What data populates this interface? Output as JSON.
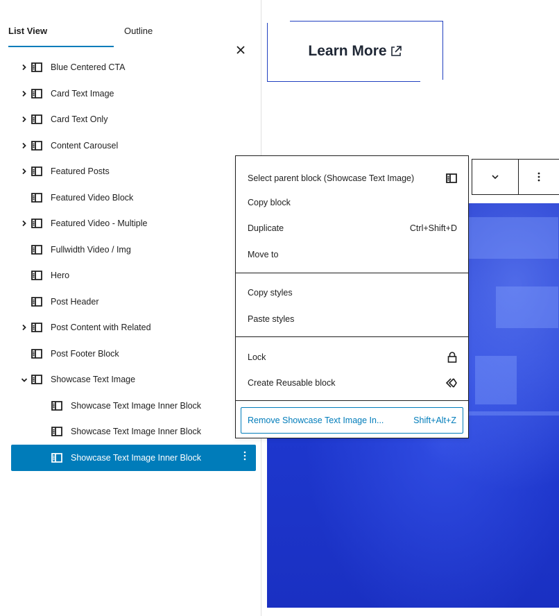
{
  "panel": {
    "tabs": {
      "list_view": "List View",
      "outline": "Outline"
    },
    "close": "×",
    "items": [
      {
        "label": "Blue Centered CTA",
        "expandable": true,
        "expanded": false,
        "depth": 0
      },
      {
        "label": "Card Text Image",
        "expandable": true,
        "expanded": false,
        "depth": 0
      },
      {
        "label": "Card Text Only",
        "expandable": true,
        "expanded": false,
        "depth": 0
      },
      {
        "label": "Content Carousel",
        "expandable": true,
        "expanded": false,
        "depth": 0
      },
      {
        "label": "Featured Posts",
        "expandable": true,
        "expanded": false,
        "depth": 0
      },
      {
        "label": "Featured Video Block",
        "expandable": false,
        "expanded": false,
        "depth": 0
      },
      {
        "label": "Featured Video - Multiple",
        "expandable": true,
        "expanded": false,
        "depth": 0
      },
      {
        "label": "Fullwidth Video / Img",
        "expandable": false,
        "expanded": false,
        "depth": 0
      },
      {
        "label": "Hero",
        "expandable": false,
        "expanded": false,
        "depth": 0
      },
      {
        "label": "Post Header",
        "expandable": false,
        "expanded": false,
        "depth": 0
      },
      {
        "label": "Post Content with Related",
        "expandable": true,
        "expanded": false,
        "depth": 0
      },
      {
        "label": "Post Footer Block",
        "expandable": false,
        "expanded": false,
        "depth": 0
      },
      {
        "label": "Showcase Text Image",
        "expandable": true,
        "expanded": true,
        "depth": 0
      },
      {
        "label": "Showcase Text Image Inner Block",
        "expandable": false,
        "expanded": false,
        "depth": 1
      },
      {
        "label": "Showcase Text Image Inner Block",
        "expandable": false,
        "expanded": false,
        "depth": 1
      },
      {
        "label": "Showcase Text Image Inner Block",
        "expandable": false,
        "expanded": false,
        "depth": 1,
        "selected": true
      }
    ]
  },
  "canvas": {
    "learn_more": "Learn More"
  },
  "menu": {
    "select_parent": "Select parent block (Showcase Text Image)",
    "copy_block": "Copy block",
    "duplicate": "Duplicate",
    "duplicate_shortcut": "Ctrl+Shift+D",
    "move_to": "Move to",
    "copy_styles": "Copy styles",
    "paste_styles": "Paste styles",
    "lock": "Lock",
    "create_reusable": "Create Reusable block",
    "remove": "Remove Showcase Text Image In...",
    "remove_shortcut": "Shift+Alt+Z"
  },
  "colors": {
    "accent": "#007cba",
    "hero": "#1f3ad2"
  }
}
